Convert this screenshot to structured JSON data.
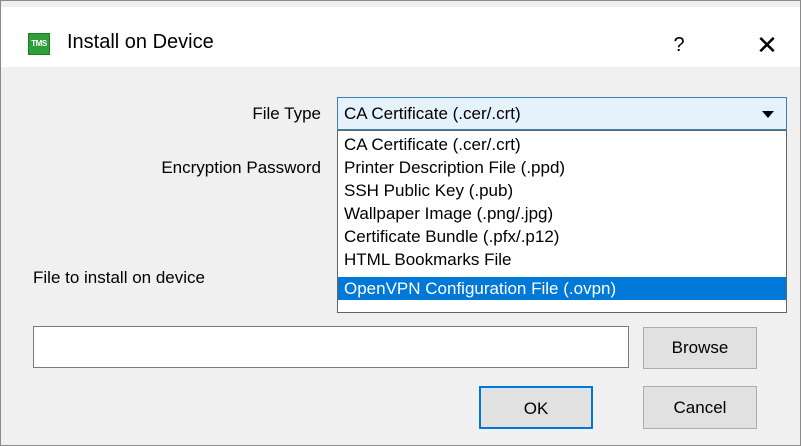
{
  "window": {
    "title": "Install on Device",
    "icon_text": "TMS",
    "help_label": "?",
    "close_label": "✕"
  },
  "form": {
    "file_type_label": "File Type",
    "encryption_password_label": "Encryption Password",
    "file_to_install_label": "File to install on device",
    "path_value": ""
  },
  "file_type": {
    "selected_value": "CA Certificate (.cer/.crt)",
    "options": [
      "CA Certificate (.cer/.crt)",
      "Printer Description File (.ppd)",
      "SSH Public Key (.pub)",
      "Wallpaper Image (.png/.jpg)",
      "Certificate Bundle (.pfx/.p12)",
      "HTML Bookmarks File",
      "OpenVPN Configuration File (.ovpn)"
    ],
    "highlighted_option": "OpenVPN Configuration File (.ovpn)"
  },
  "buttons": {
    "browse": "Browse",
    "ok": "OK",
    "cancel": "Cancel"
  },
  "colors": {
    "highlight": "#0078d7",
    "app_icon": "#2e9e3a"
  }
}
